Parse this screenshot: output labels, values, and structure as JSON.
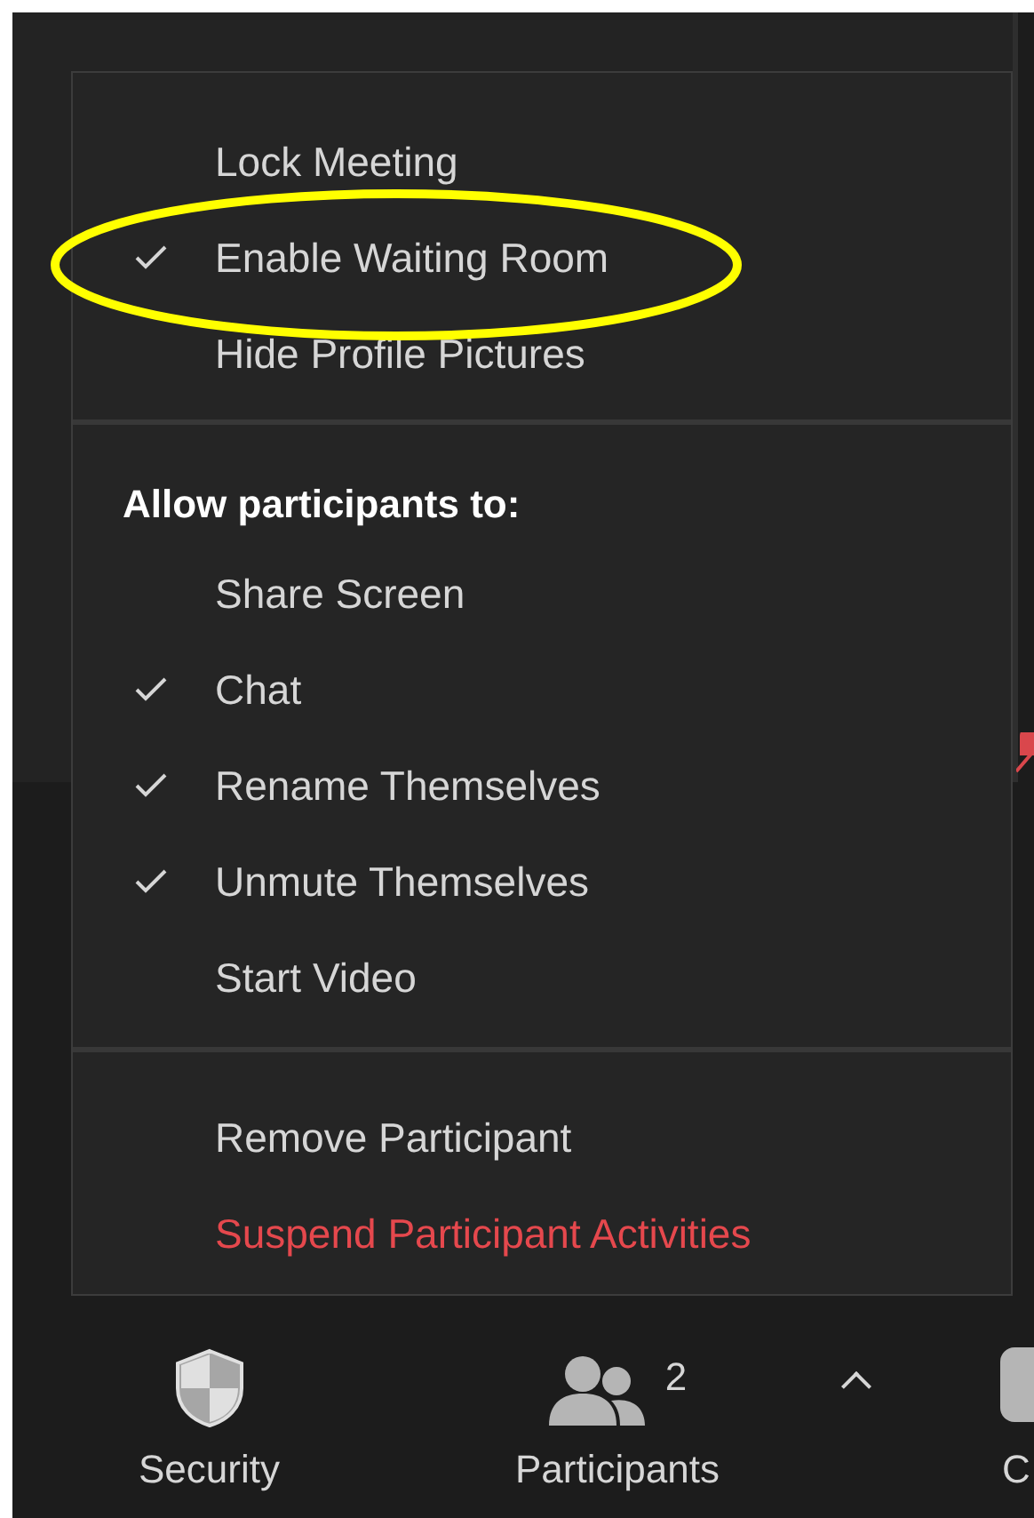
{
  "security_menu": {
    "sections": [
      {
        "items": [
          {
            "label": "Lock Meeting",
            "checked": false,
            "kind": "option"
          },
          {
            "label": "Enable Waiting Room",
            "checked": true,
            "kind": "option"
          },
          {
            "label": "Hide Profile Pictures",
            "checked": false,
            "kind": "option"
          }
        ]
      },
      {
        "heading": "Allow participants to:",
        "items": [
          {
            "label": "Share Screen",
            "checked": false,
            "kind": "option"
          },
          {
            "label": "Chat",
            "checked": true,
            "kind": "option"
          },
          {
            "label": "Rename Themselves",
            "checked": true,
            "kind": "option"
          },
          {
            "label": "Unmute Themselves",
            "checked": true,
            "kind": "option"
          },
          {
            "label": "Start Video",
            "checked": false,
            "kind": "option"
          }
        ]
      },
      {
        "items": [
          {
            "label": "Remove Participant",
            "kind": "action"
          },
          {
            "label": "Suspend Participant Activities",
            "kind": "danger"
          }
        ]
      }
    ]
  },
  "toolbar": [
    {
      "kind": "security",
      "label": "Security"
    },
    {
      "kind": "participants",
      "label": "Participants",
      "count": "2"
    },
    {
      "kind": "cut",
      "label": "C"
    }
  ]
}
